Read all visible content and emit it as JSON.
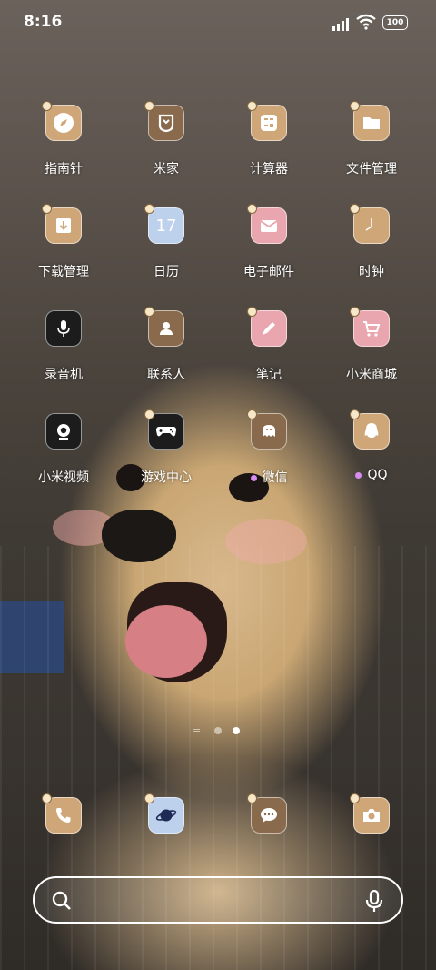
{
  "status_bar": {
    "time": "8:16",
    "battery": "100"
  },
  "apps": [
    {
      "label": "指南针",
      "icon": "compass-icon",
      "new": false
    },
    {
      "label": "米家",
      "icon": "mijia-icon",
      "new": false
    },
    {
      "label": "计算器",
      "icon": "calculator-icon",
      "new": false
    },
    {
      "label": "文件管理",
      "icon": "folder-icon",
      "new": false
    },
    {
      "label": "下载管理",
      "icon": "download-icon",
      "new": false
    },
    {
      "label": "日历",
      "icon": "calendar-icon",
      "new": false,
      "badge": "17"
    },
    {
      "label": "电子邮件",
      "icon": "mail-icon",
      "new": false
    },
    {
      "label": "时钟",
      "icon": "clock-icon",
      "new": false
    },
    {
      "label": "录音机",
      "icon": "microphone-icon",
      "new": false
    },
    {
      "label": "联系人",
      "icon": "contact-icon",
      "new": false
    },
    {
      "label": "笔记",
      "icon": "pencil-icon",
      "new": false
    },
    {
      "label": "小米商城",
      "icon": "cart-icon",
      "new": false
    },
    {
      "label": "小米视频",
      "icon": "video-icon",
      "new": false
    },
    {
      "label": "游戏中心",
      "icon": "gamepad-icon",
      "new": false
    },
    {
      "label": "微信",
      "icon": "wechat-icon",
      "new": true
    },
    {
      "label": "QQ",
      "icon": "qq-icon",
      "new": true
    }
  ],
  "dock": [
    {
      "icon": "phone-icon"
    },
    {
      "icon": "browser-icon"
    },
    {
      "icon": "message-icon"
    },
    {
      "icon": "camera-icon"
    }
  ],
  "pager": {
    "pages": 2,
    "current": 2
  },
  "search": {
    "placeholder": ""
  },
  "colors": {
    "tan": "#cfa678",
    "brown": "#8a6a4c",
    "pink": "#e9a6ae",
    "blue": "#bdd0ec",
    "new_dot": "#d68cf0"
  }
}
